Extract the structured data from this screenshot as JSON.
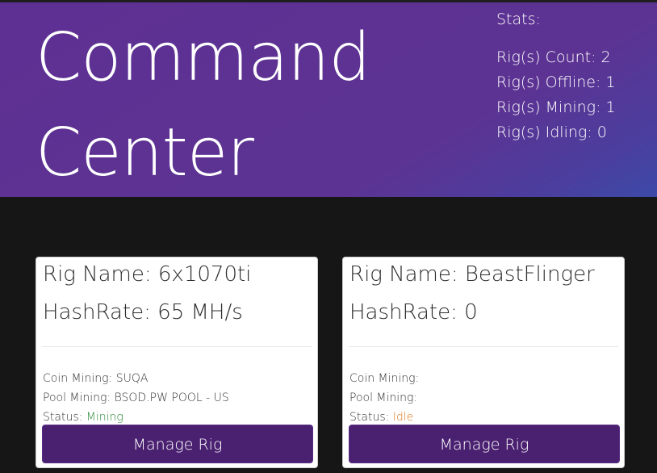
{
  "header": {
    "title_line1": "Command",
    "title_line2": "Center",
    "colors": {
      "gradient_start": "#5e3093",
      "gradient_end": "#3c4aa8"
    }
  },
  "stats": {
    "heading": "Stats:",
    "lines": [
      "Rig(s) Count: 2",
      "Rig(s) Offline: 1",
      "Rig(s) Mining: 1",
      "Rig(s) Idling: 0"
    ]
  },
  "rigs": [
    {
      "name_label": "Rig Name: 6x1070ti",
      "hashrate_label": "HashRate: 65 MH/s",
      "coin_label": "Coin Mining: SUQA",
      "pool_label": "Pool Mining: BSOD.PW POOL - US",
      "status_prefix": "Status: ",
      "status_value": "Mining",
      "status_color": "#2e8b3a",
      "button_label": "Manage Rig"
    },
    {
      "name_label": "Rig Name: BeastFlinger",
      "hashrate_label": "HashRate: 0",
      "coin_label": "Coin Mining:",
      "pool_label": "Pool Mining:",
      "status_prefix": "Status: ",
      "status_value": "Idle",
      "status_color": "#e07a1f",
      "button_label": "Manage Rig"
    }
  ],
  "colors": {
    "page_background": "#161616",
    "button_background": "#4a2070"
  }
}
